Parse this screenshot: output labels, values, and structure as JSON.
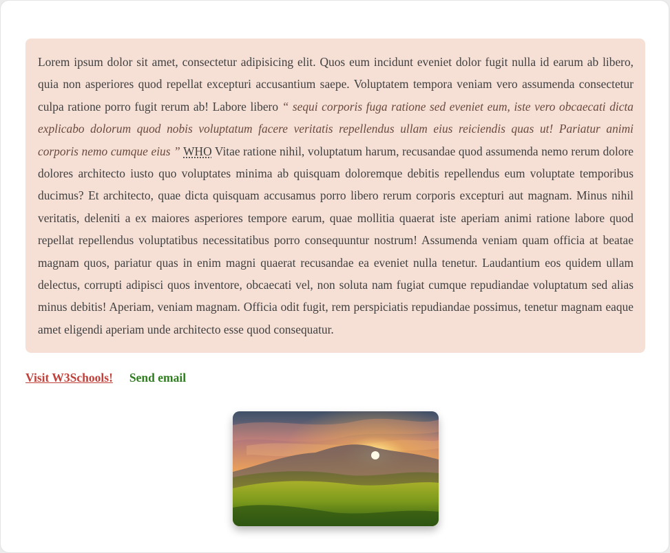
{
  "article": {
    "text_before_quote": "Lorem ipsum dolor sit amet, consectetur adipisicing elit. Quos eum incidunt eveniet dolor fugit nulla id earum ab libero, quia non asperiores quod repellat excepturi accusantium saepe. Voluptatem tempora veniam vero assumenda consectetur culpa ratione porro fugit rerum ab! Labore libero ",
    "quote": "“ sequi corporis fuga ratione sed eveniet eum, iste vero obcaecati dicta explicabo dolorum quod nobis voluptatum facere veritatis repellendus ullam eius reiciendis quas ut! Pariatur animi corporis nemo cumque eius ”",
    "abbr": "WHO",
    "text_after_abbr": " Vitae ratione nihil, voluptatum harum, recusandae quod assumenda nemo rerum dolore dolores architecto iusto quo voluptates minima ab quisquam doloremque debitis repellendus eum voluptate temporibus ducimus? Et architecto, quae dicta quisquam accusamus porro libero rerum corporis excepturi aut magnam. Minus nihil veritatis, deleniti a ex maiores asperiores tempore earum, quae mollitia quaerat iste aperiam animi ratione labore quod repellat repellendus voluptatibus necessitatibus porro consequuntur nostrum! Assumenda veniam quam officia at beatae magnam quos, pariatur quas in enim magni quaerat recusandae ea eveniet nulla tenetur. Laudantium eos quidem ullam delectus, corrupti adipisci quos inventore, obcaecati vel, non soluta nam fugiat cumque repudiandae voluptatum sed alias minus debitis! Aperiam, veniam magnam. Officia odit fugit, rem perspiciatis repudiandae possimus, tenetur magnam eaque amet eligendi aperiam unde architecto esse quod consequatur."
  },
  "links": {
    "w3schools_label": "Visit W3Schools!",
    "email_label": "Send email"
  },
  "colors": {
    "box_background": "#f6e0d6",
    "link_w3": "#c0413b",
    "link_email": "#2e7d1e"
  },
  "image": {
    "subject": "sunset-over-grassy-mountains"
  }
}
